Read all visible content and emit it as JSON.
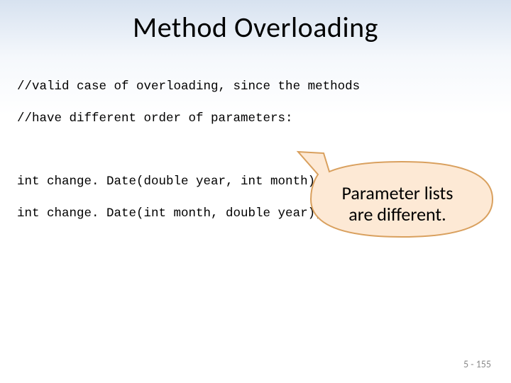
{
  "title": "Method Overloading",
  "code": {
    "comment1": "//valid case of overloading, since the methods",
    "comment2": "//have different order of parameters:",
    "line1": "int change. Date(double year, int month) ;",
    "line2": "int change. Date(int month, double year);"
  },
  "callout": {
    "line1": "Parameter lists",
    "line2": "are different."
  },
  "footer": "5 - 155"
}
